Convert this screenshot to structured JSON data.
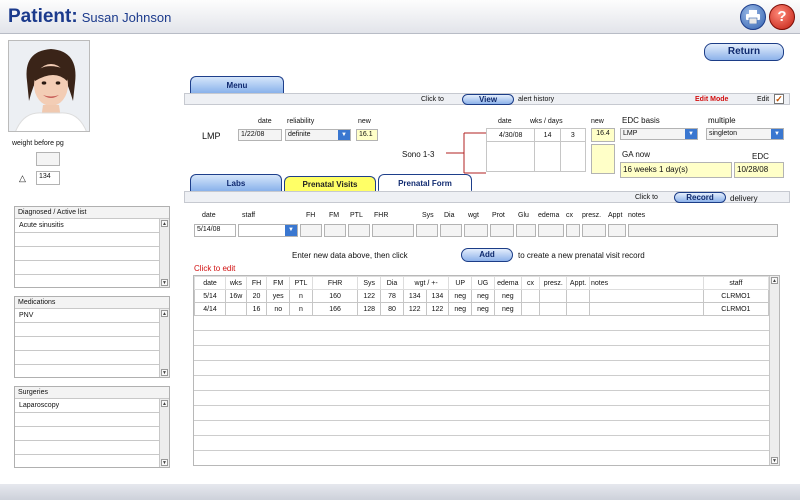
{
  "header": {
    "title": "Patient:",
    "patient_name": "Susan Johnson"
  },
  "icons": {
    "print": "printer-icon",
    "help": "?"
  },
  "left": {
    "weight_label": "weight before pg",
    "weight_value": "",
    "height_value": "134",
    "diagnosed": {
      "title": "Diagnosed / Active list",
      "items": [
        "Acute sinusitis",
        "",
        "",
        "",
        ""
      ]
    },
    "medications": {
      "title": "Medications",
      "items": [
        "PNV",
        "",
        "",
        "",
        ""
      ]
    },
    "surgeries": {
      "title": "Surgeries",
      "items": [
        "Laparoscopy",
        "",
        "",
        "",
        ""
      ]
    }
  },
  "return_label": "Return",
  "tabs": {
    "menu": "Menu",
    "labs": "Labs",
    "prenatal_visits": "Prenatal Visits",
    "prenatal_form": "Prenatal Form"
  },
  "alert_bar": {
    "pre": "Click to",
    "button": "View",
    "post": "alert history",
    "edit_mode": "Edit Mode",
    "edit_label": "Edit"
  },
  "lmp": {
    "label": "LMP",
    "col_date": "date",
    "col_reliability": "reliability",
    "col_new": "new",
    "date": "1/22/08",
    "reliability": "definite",
    "new": "16.1"
  },
  "sono": {
    "label": "Sono 1-3",
    "col_date": "date",
    "col_wks": "wks / days",
    "col_new": "new",
    "rows": [
      {
        "date": "4/30/08",
        "wks": "14",
        "days": "3",
        "new": "16.4"
      },
      {
        "date": "",
        "wks": "",
        "days": "",
        "new": ""
      }
    ]
  },
  "edc_basis": {
    "label": "EDC basis",
    "value": "LMP"
  },
  "multiple": {
    "label": "multiple",
    "value": "singleton"
  },
  "ga_now": {
    "label": "GA now",
    "value": "16 weeks 1 day(s)"
  },
  "edc": {
    "label": "EDC",
    "value": "10/28/08"
  },
  "delivery_bar": {
    "pre": "Click to",
    "button": "Record",
    "post": "delivery"
  },
  "entry": {
    "headers": [
      "date",
      "staff",
      "FH",
      "FM",
      "PTL",
      "FHR",
      "Sys",
      "Dia",
      "wgt",
      "Prot",
      "Glu",
      "edema",
      "cx",
      "presz.",
      "Appt",
      "notes"
    ],
    "date_value": "5/14/08",
    "instruction_pre": "Enter new data above, then click",
    "add_label": "Add",
    "instruction_post": "to create a new prenatal visit record"
  },
  "click_to_edit": "Click to edit",
  "visits": {
    "headers": [
      "date",
      "wks",
      "FH",
      "FM",
      "PTL",
      "FHR",
      "Sys",
      "Dia",
      "wgt / +-",
      "UP",
      "UG",
      "edema",
      "cx",
      "presz.",
      "Appt.",
      "notes",
      "staff"
    ],
    "rows": [
      [
        "5/14",
        "16w",
        "20",
        "yes",
        "n",
        "160",
        "122",
        "78",
        "134",
        "134",
        "neg",
        "neg",
        "neg",
        "",
        "",
        "",
        "",
        "CLRMO1"
      ],
      [
        "4/14",
        "",
        "16",
        "no",
        "n",
        "166",
        "128",
        "80",
        "122",
        "122",
        "neg",
        "neg",
        "neg",
        "",
        "",
        "",
        "",
        "CLRMO1"
      ]
    ]
  }
}
